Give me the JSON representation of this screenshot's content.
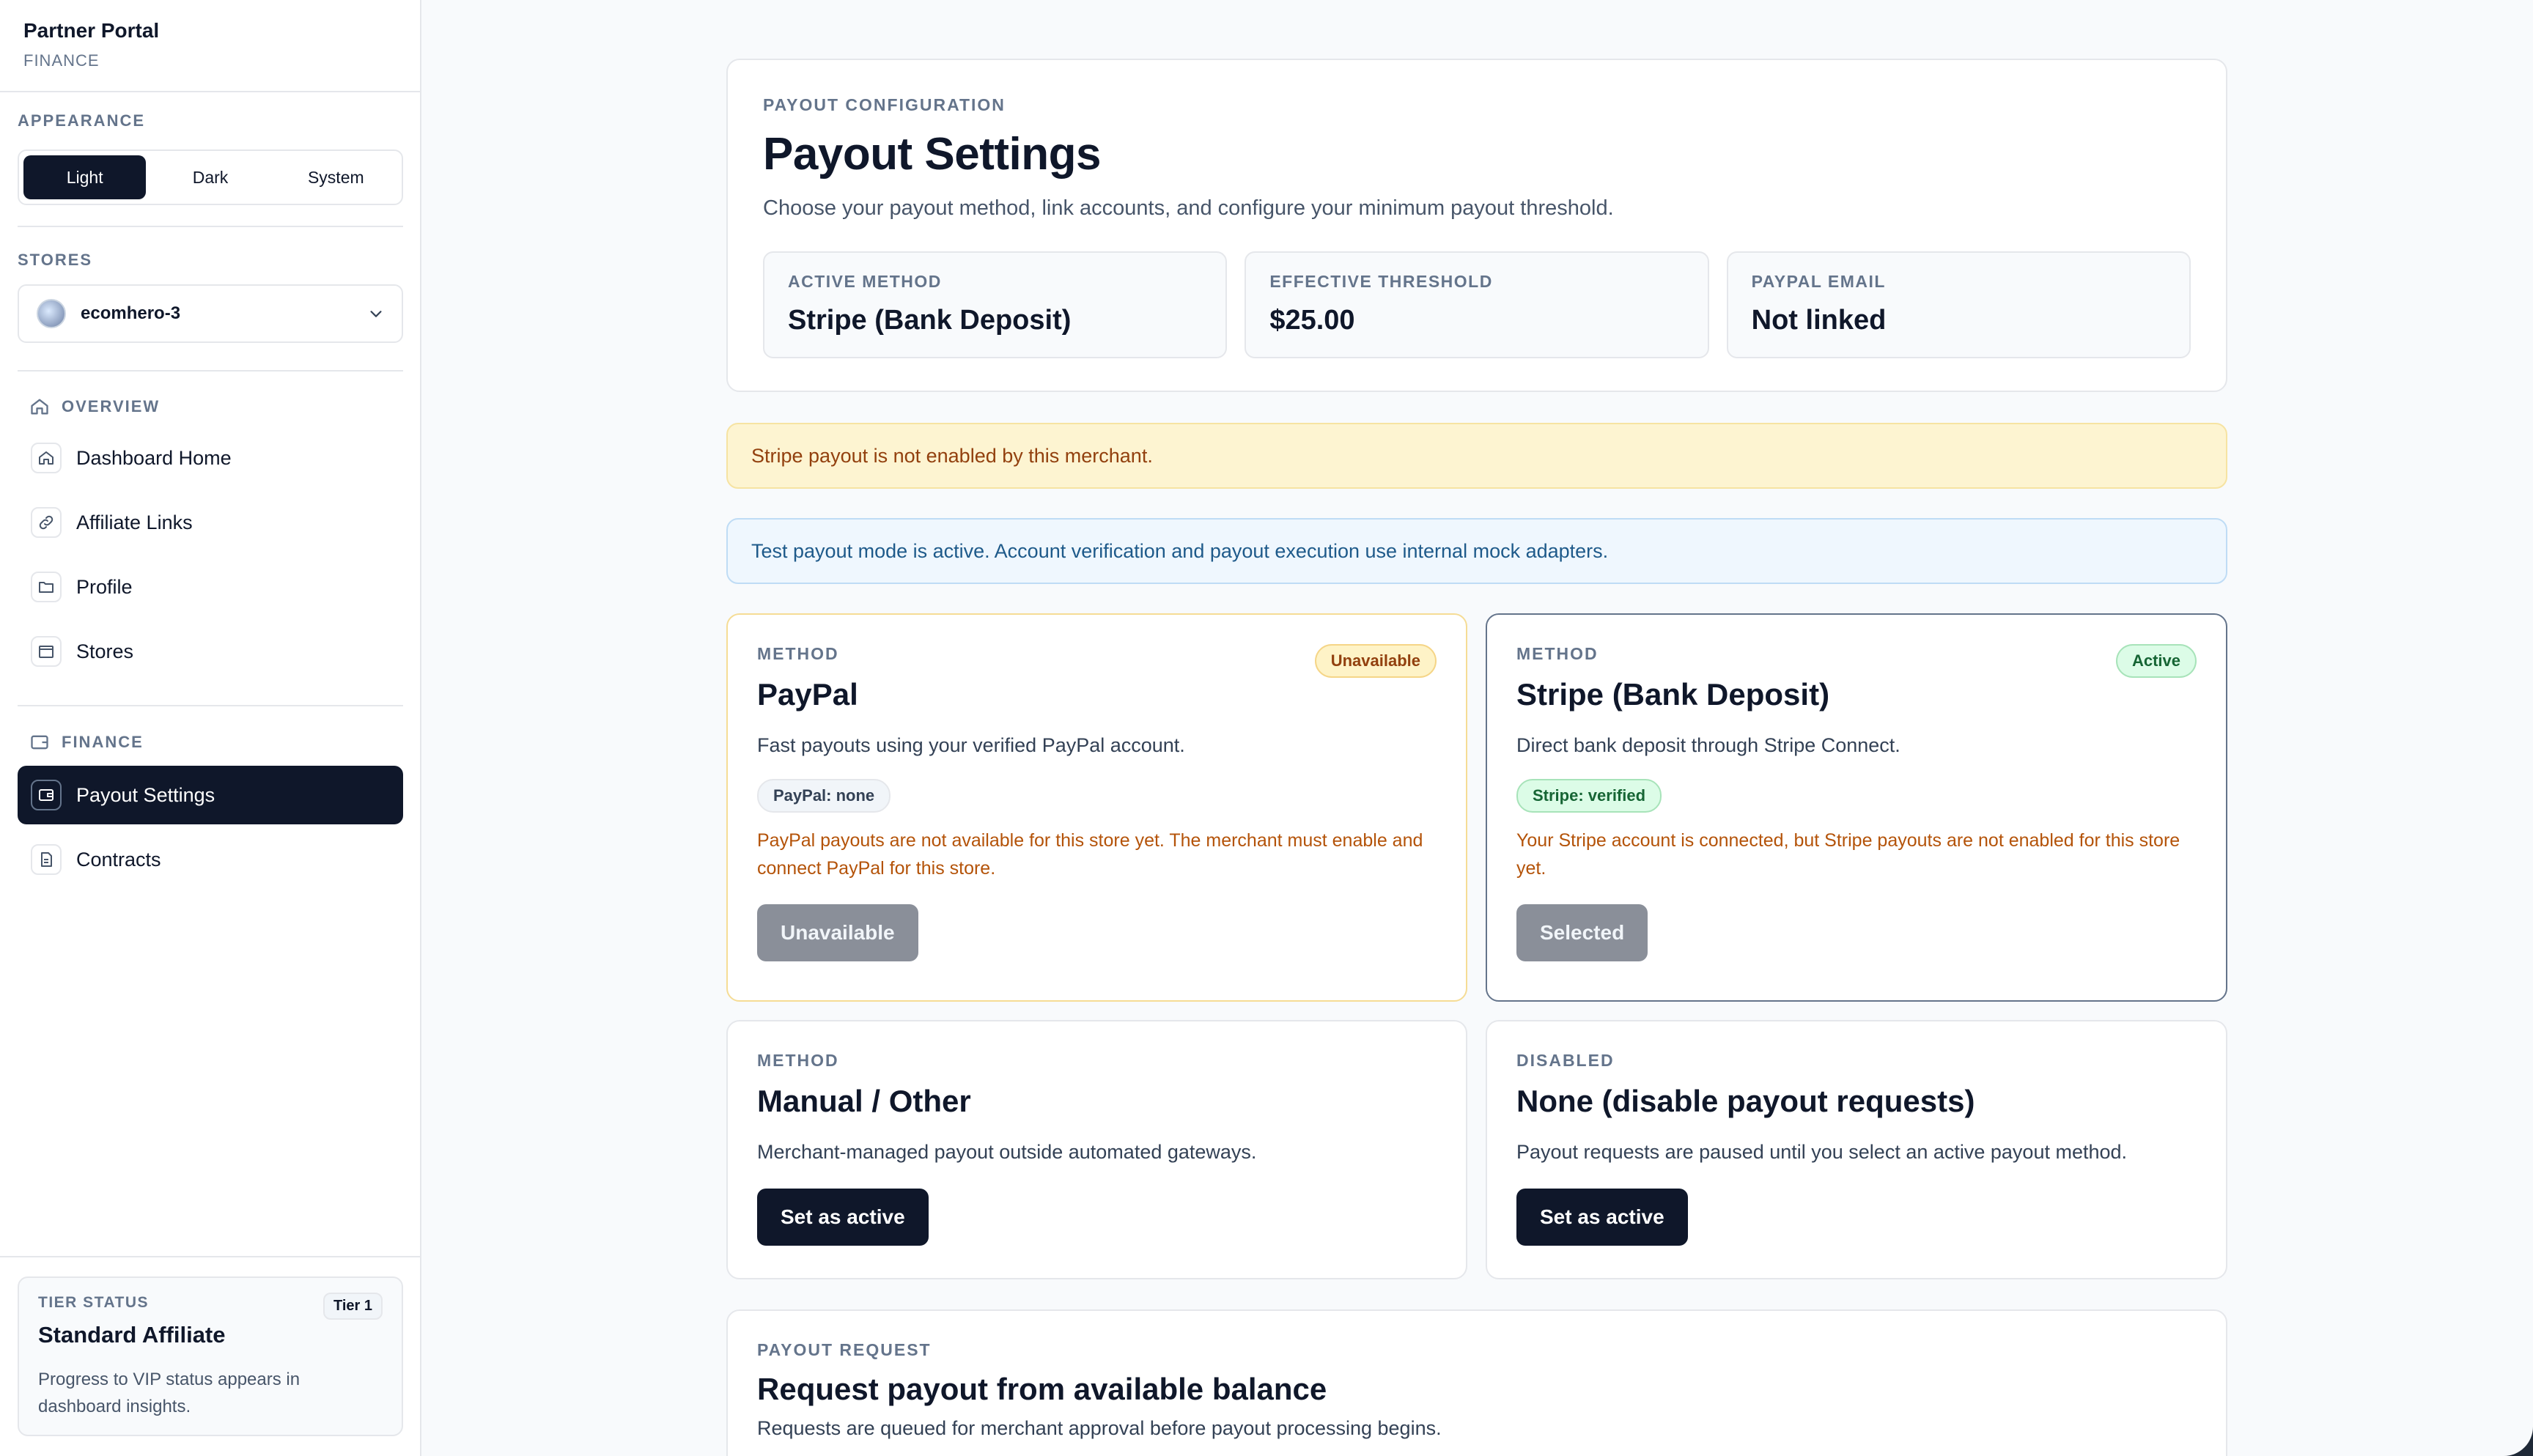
{
  "app": {
    "title": "Partner Portal",
    "subtitle": "FINANCE"
  },
  "appearance": {
    "label": "APPEARANCE",
    "options": [
      "Light",
      "Dark",
      "System"
    ],
    "selected": "Light"
  },
  "stores": {
    "label": "STORES",
    "selected": "ecomhero-3"
  },
  "nav": {
    "overview_label": "OVERVIEW",
    "overview_items": [
      "Dashboard Home",
      "Affiliate Links",
      "Profile",
      "Stores"
    ],
    "finance_label": "FINANCE",
    "finance_items": [
      "Payout Settings",
      "Contracts"
    ],
    "active": "Payout Settings"
  },
  "tier": {
    "label": "TIER STATUS",
    "badge": "Tier 1",
    "title": "Standard Affiliate",
    "desc": "Progress to VIP status appears in dashboard insights."
  },
  "header": {
    "eyebrow": "PAYOUT CONFIGURATION",
    "title": "Payout Settings",
    "subtitle": "Choose your payout method, link accounts, and configure your minimum payout threshold.",
    "stats": [
      {
        "label": "ACTIVE METHOD",
        "value": "Stripe (Bank Deposit)"
      },
      {
        "label": "EFFECTIVE THRESHOLD",
        "value": "$25.00"
      },
      {
        "label": "PAYPAL EMAIL",
        "value": "Not linked"
      }
    ]
  },
  "alerts": {
    "warning": "Stripe payout is not enabled by this merchant.",
    "info": "Test payout mode is active. Account verification and payout execution use internal mock adapters."
  },
  "methods": {
    "paypal": {
      "eyebrow": "METHOD",
      "badge": "Unavailable",
      "title": "PayPal",
      "desc": "Fast payouts using your verified PayPal account.",
      "pill": "PayPal: none",
      "warning": "PayPal payouts are not available for this store yet. The merchant must enable and connect PayPal for this store.",
      "button": "Unavailable"
    },
    "stripe": {
      "eyebrow": "METHOD",
      "badge": "Active",
      "title": "Stripe (Bank Deposit)",
      "desc": "Direct bank deposit through Stripe Connect.",
      "pill": "Stripe: verified",
      "warning": "Your Stripe account is connected, but Stripe payouts are not enabled for this store yet.",
      "button": "Selected"
    },
    "manual": {
      "eyebrow": "METHOD",
      "title": "Manual / Other",
      "desc": "Merchant-managed payout outside automated gateways.",
      "button": "Set as active"
    },
    "none": {
      "eyebrow": "DISABLED",
      "title": "None (disable payout requests)",
      "desc": "Payout requests are paused until you select an active payout method.",
      "button": "Set as active"
    }
  },
  "request": {
    "eyebrow": "PAYOUT REQUEST",
    "title": "Request payout from available balance",
    "subtitle": "Requests are queued for merchant approval before payout processing begins."
  },
  "colors": {
    "primary": "#0f172a",
    "warning_bg": "#fdf4d1",
    "info_bg": "#eff7fe",
    "active_green": "#16a34a",
    "unavailable_amber": "#b45309"
  }
}
